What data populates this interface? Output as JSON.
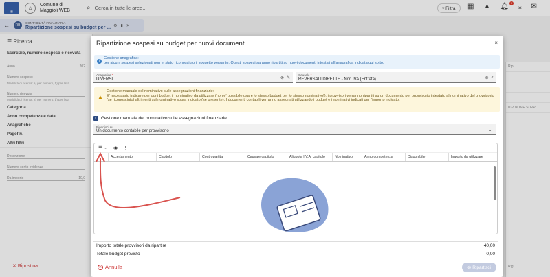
{
  "topbar": {
    "app_name": "Comune di Maggioli WEB",
    "search_placeholder": "Cerca in tutte le aree...",
    "filter_label": "Filtra",
    "notification_count": "9"
  },
  "tab": {
    "small": "CONTABILITÀ FINANZIARIA",
    "title": "Ripartizione sospesi su budget per ..."
  },
  "left": {
    "title": "Ricerca",
    "section_search": "Esercizio, numero sospeso e ricevuta",
    "anno_label": "Anno",
    "anno_value": "202",
    "num_sospeso": "Numero sospeso",
    "hint1": "Modalità di ricerca: a) per numero, b) per lista",
    "num_ricevuta": "Numero ricevuta",
    "hint2": "Modalità di ricerca: a) per numero, b) per lista",
    "sections": [
      "Categoria",
      "Anno competenza e data",
      "Anagrafiche",
      "PagoPA",
      "Altri filtri"
    ],
    "descrizione": "Descrizione",
    "nome_evidenza": "Numero conto evidenza",
    "da_importo": "Da importo",
    "da_importo_val": "10,0",
    "ripristina": "Ripristina"
  },
  "right": {
    "col": "Rip",
    "cell": "032 NOME SUPP",
    "footer": "Rig"
  },
  "modal": {
    "title": "Ripartizione sospesi su budget per nuovi documenti",
    "close": "×",
    "info_title": "Gestione anagrafica:",
    "info_text": "per alcuni sospesi selezionati non e' stato riconosciuto il soggetto versante. Questi sospesi saranno ripartiti su nuovi documenti intestati all'anagrafica indicata qui sotto.",
    "anagrafica_label": "Anagrafica",
    "anagrafica_value": "DIVERSI",
    "causale_label": "Causale",
    "causale_value": "REVERSALI DIRETTE - Non IVA (Entrata)",
    "warn_title": "Gestione manuale del nominativo sulle assegnazioni finanziarie:",
    "warn_text": "E' necessario indicare per ogni budget il nominativo da utilizzare (non e' possibile usare lo stesso budget per lo stesso nominativo!); i provvisori verranno ripartiti su un documento per provvisorio intestato al nominativo del provvisorio (se riconosciuto) altrimenti sul nominativo sopra indicato (se presente). I documenti contabili verranno assegnati utilizzando i budget e i nominativi indicati per l'importo indicato.",
    "checkbox_label": "Gestione manuale del nominativo sulle assegnazioni finanziarie",
    "ripartisci_su_label": "Ripartisci su",
    "ripartisci_su_value": "Un documento contabile per provvisorio",
    "columns": [
      "Accertamento",
      "Capitolo",
      "Contropartita",
      "Causale capitolo",
      "Aliquota I.V.A. capitolo",
      "Nominativo",
      "Anno competenza",
      "Disponibile",
      "Importo da utilizzare"
    ],
    "totale_provvisori_label": "Importo totale provvisori da ripartire",
    "totale_provvisori_value": "40,00",
    "totale_budget_label": "Totale budget previsto",
    "totale_budget_value": "0,00",
    "annulla": "Annulla",
    "ripartisci": "Ripartisci"
  }
}
